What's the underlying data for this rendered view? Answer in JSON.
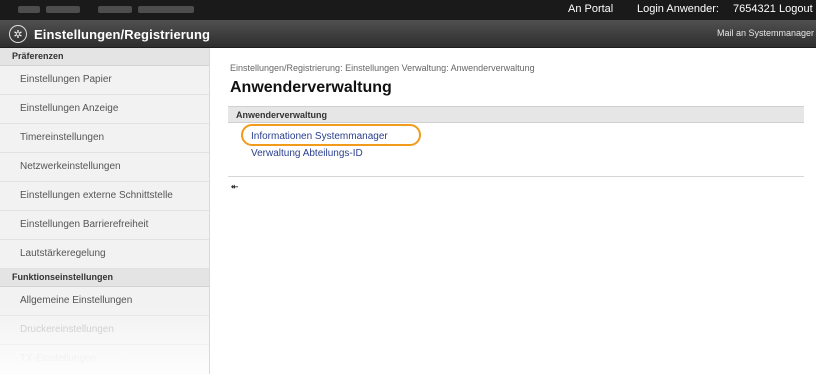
{
  "topbar": {
    "portal_link": "An Portal",
    "login_label": "Login Anwender:",
    "login_id": "7654321",
    "logout_link": "Logout"
  },
  "header": {
    "app_icon": "settings-icon",
    "title": "Einstellungen/Registrierung",
    "mail_link": "Mail an Systemmanager"
  },
  "sidebar": {
    "sections": [
      {
        "label": "Präferenzen",
        "items": [
          {
            "label": "Einstellungen Papier"
          },
          {
            "label": "Einstellungen Anzeige"
          },
          {
            "label": "Timereinstellungen"
          },
          {
            "label": "Netzwerkeinstellungen"
          },
          {
            "label": "Einstellungen externe Schnittstelle"
          },
          {
            "label": "Einstellungen Barrierefreiheit"
          },
          {
            "label": "Lautstärkeregelung"
          }
        ]
      },
      {
        "label": "Funktionseinstellungen",
        "items": [
          {
            "label": "Allgemeine Einstellungen"
          },
          {
            "label": "Druckereinstellungen"
          },
          {
            "label": "TX-Einstellungen"
          }
        ]
      }
    ]
  },
  "main": {
    "breadcrumb": "Einstellungen/Registrierung: Einstellungen Verwaltung: Anwenderverwaltung",
    "page_title": "Anwenderverwaltung",
    "panel_header": "Anwenderverwaltung",
    "links": [
      {
        "label": "Informationen Systemmanager"
      },
      {
        "label": "Verwaltung Abteilungs-ID"
      }
    ],
    "highlight_color": "#f29b1b",
    "top_icon": "to-top-icon",
    "top_glyph": "⯬"
  }
}
